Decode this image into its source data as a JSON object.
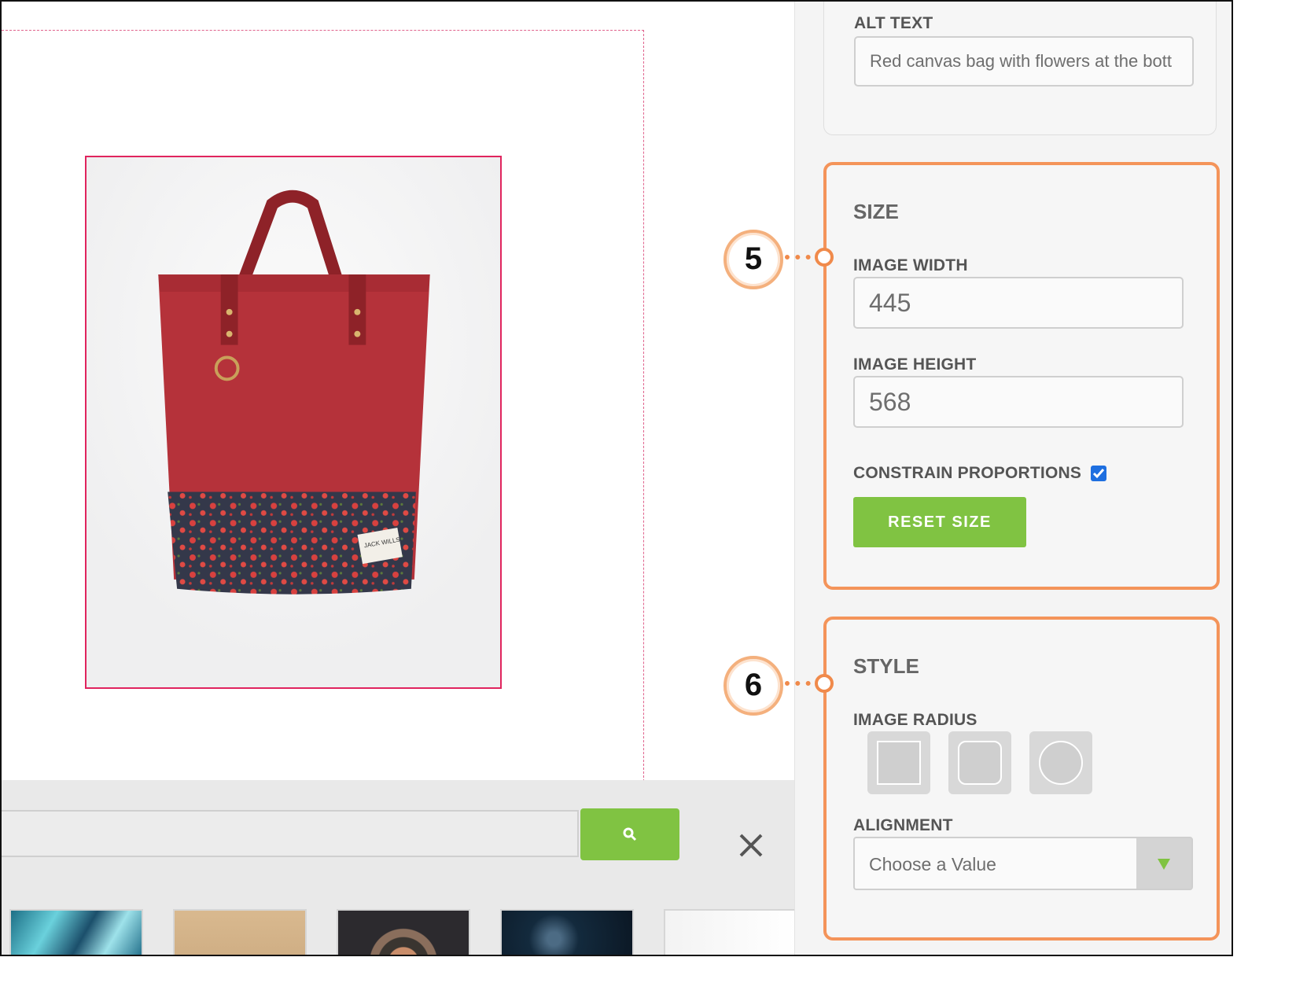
{
  "alt_text": {
    "label": "ALT TEXT",
    "value": "Red canvas bag with flowers at the bott"
  },
  "size": {
    "title": "SIZE",
    "width_label": "IMAGE WIDTH",
    "width_value": "445",
    "height_label": "IMAGE HEIGHT",
    "height_value": "568",
    "constrain_label": "CONSTRAIN PROPORTIONS",
    "constrain_checked": true,
    "reset_label": "RESET SIZE"
  },
  "style": {
    "title": "STYLE",
    "radius_label": "IMAGE RADIUS",
    "radius_options": [
      "square-radius-icon",
      "rounded-radius-icon",
      "circle-radius-icon"
    ],
    "alignment_label": "ALIGNMENT",
    "alignment_value": "Choose a Value"
  },
  "callouts": {
    "size": "5",
    "style": "6"
  },
  "picker": {
    "search_value": ""
  },
  "canvas": {
    "image_label": "JACK WILLS"
  },
  "colors": {
    "accent_green": "#80c342",
    "highlight_orange": "#f4945a",
    "selection_pink": "#e0245e",
    "checkbox_blue": "#1e6fe0"
  }
}
